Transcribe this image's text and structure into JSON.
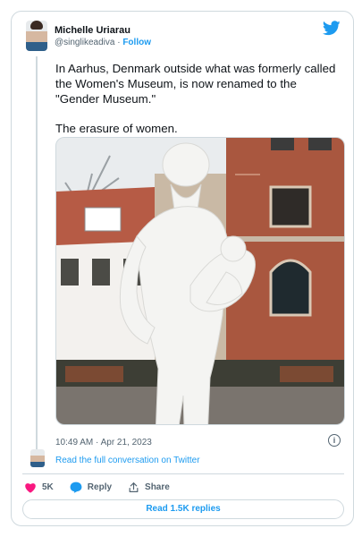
{
  "author": {
    "name": "Michelle Uriarau",
    "handle": "@singlikeadiva",
    "separator": "·",
    "follow_label": "Follow"
  },
  "tweet": {
    "paragraphs": [
      "In Aarhus, Denmark outside what was formerly called the Women's Museum, is now renamed to the \"Gender Museum.\"",
      "The erasure of women."
    ],
    "timestamp": "10:49 AM · Apr 21, 2023",
    "info_icon": "i"
  },
  "conversation": {
    "link_label": "Read the full conversation on Twitter"
  },
  "actions": {
    "likes": "5K",
    "reply_label": "Reply",
    "share_label": "Share"
  },
  "read_replies_label": "Read 1.5K replies",
  "colors": {
    "accent": "#1d9bf0",
    "like": "#f91880",
    "muted": "#536471",
    "border": "#cfd9de"
  },
  "icons": {
    "brand": "twitter-bird-icon",
    "like": "heart-icon",
    "reply": "speech-bubble-icon",
    "share": "share-arrow-icon",
    "info": "info-icon"
  }
}
